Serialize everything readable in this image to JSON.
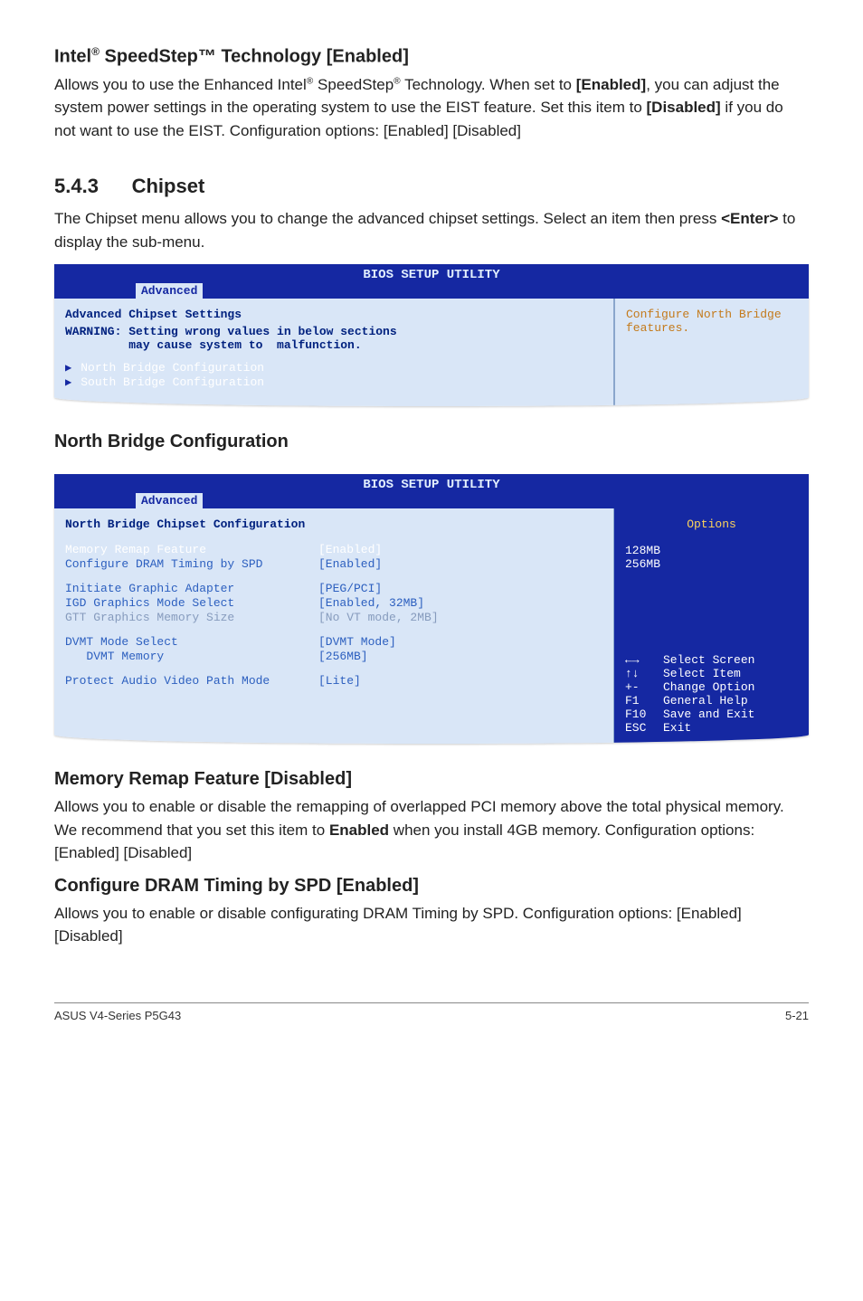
{
  "section1": {
    "heading_pre": "Intel",
    "heading_sup1": "®",
    "heading_mid": " SpeedStep™ Technology [Enabled]",
    "p1_a": "Allows you to use the Enhanced Intel",
    "p1_sup": "®",
    "p1_b": " SpeedStep",
    "p1_sup2": "®",
    "p1_c": " Technology. When set to ",
    "p1_bold1": "[Enabled]",
    "p1_d": ", you can adjust the system power settings in the operating system to use the EIST feature. Set this item to ",
    "p1_bold2": "[Disabled]",
    "p1_e": " if you do not want to use the EIST. Configuration options: [Enabled] [Disabled]"
  },
  "section2": {
    "heading": "5.4.3      Chipset",
    "p_a": "The Chipset menu allows you to change the advanced chipset settings. Select an item then press ",
    "p_bold": "<Enter>",
    "p_b": " to display the sub-menu."
  },
  "bios1": {
    "title": "BIOS SETUP UTILITY",
    "tab": "Advanced",
    "left_title": "Advanced Chipset Settings",
    "warn_l1": "WARNING: Setting wrong values in below sections",
    "warn_l2": "         may cause system to  malfunction.",
    "item1": "North Bridge Configuration",
    "item2": "South Bridge Configuration",
    "right_l1": "Configure North Bridge",
    "right_l2": "features."
  },
  "nb_heading": "North Bridge Configuration",
  "bios2": {
    "title": "BIOS SETUP UTILITY",
    "tab": "Advanced",
    "left_title": "North Bridge Chipset Configuration",
    "rows": [
      {
        "label": "Memory Remap Feature",
        "value": "[Enabled]",
        "hl": true
      },
      {
        "label": "Configure DRAM Timing by SPD",
        "value": "[Enabled]",
        "hl": false
      }
    ],
    "rows2": [
      {
        "label": "Initiate Graphic Adapter",
        "value": "[PEG/PCI]"
      },
      {
        "label": "IGD Graphics Mode Select",
        "value": "[Enabled, 32MB]"
      },
      {
        "label": "GTT Graphics Memory Size",
        "value": "[No VT mode, 2MB]"
      }
    ],
    "rows3": [
      {
        "label": "DVMT Mode Select",
        "value": "[DVMT Mode]"
      },
      {
        "label": "   DVMT Memory",
        "value": "[256MB]"
      }
    ],
    "row4": {
      "label": "Protect Audio Video Path Mode",
      "value": "[Lite]"
    },
    "right_title": "Options",
    "right_opt1": "128MB",
    "right_opt2": "256MB",
    "nav": [
      {
        "k": "←→",
        "d": "Select Screen"
      },
      {
        "k": "↑↓",
        "d": "Select Item"
      },
      {
        "k": "+-",
        "d": "Change Option"
      },
      {
        "k": "F1",
        "d": "General Help"
      },
      {
        "k": "F10",
        "d": "Save and Exit"
      },
      {
        "k": "ESC",
        "d": "Exit"
      }
    ]
  },
  "section3": {
    "h1": "Memory Remap Feature [Disabled]",
    "p1_a": "Allows you to enable or disable the  remapping of overlapped PCI memory above the total physical memory. We recommend that you set this item to ",
    "p1_bold": "Enabled",
    "p1_b": " when you install 4GB memory. Configuration options: [Enabled] [Disabled]",
    "h2": "Configure DRAM Timing by SPD [Enabled]",
    "p2": "Allows you to enable or disable configurating DRAM Timing by SPD. Configuration options: [Enabled] [Disabled]"
  },
  "footer": {
    "left": "ASUS V4-Series P5G43",
    "right": "5-21"
  }
}
